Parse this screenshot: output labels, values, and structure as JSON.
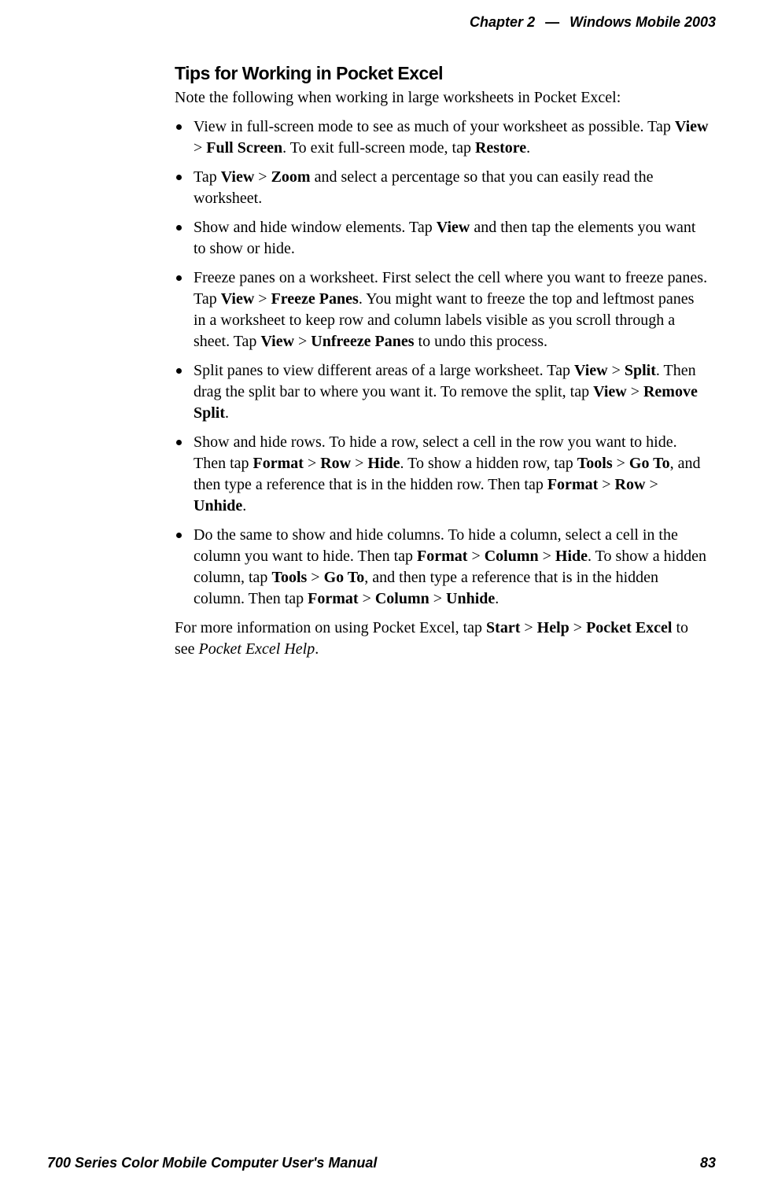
{
  "header": {
    "chapter_label": "Chapter",
    "chapter_num": "2",
    "separator": "—",
    "doc_title": "Windows Mobile 2003"
  },
  "section": {
    "title": "Tips for Working in Pocket Excel",
    "intro": "Note the following when working in large worksheets in Pocket Excel:"
  },
  "bullets": {
    "b1": {
      "pre": "View in full-screen mode to see as much of your worksheet as possible. Tap ",
      "s1": "View",
      "gt1": " > ",
      "s2": "Full Screen",
      "mid": ". To exit full-screen mode, tap ",
      "s3": "Restore",
      "end": "."
    },
    "b2": {
      "pre": "Tap ",
      "s1": "View",
      "gt1": " > ",
      "s2": "Zoom",
      "end": " and select a percentage so that you can easily read the worksheet."
    },
    "b3": {
      "pre": "Show and hide window elements. Tap ",
      "s1": "View",
      "end": " and then tap the elements you want to show or hide."
    },
    "b4": {
      "pre": "Freeze panes on a worksheet. First select the cell where you want to freeze panes. Tap ",
      "s1": "View",
      "gt1": " > ",
      "s2": "Freeze Panes",
      "mid": ". You might want to freeze the top and leftmost panes in a worksheet to keep row and column labels visible as you scroll through a sheet. Tap ",
      "s3": "View",
      "gt2": " > ",
      "s4": "Unfreeze Panes",
      "end": " to undo this process."
    },
    "b5": {
      "pre": "Split panes to view different areas of a large worksheet. Tap ",
      "s1": "View",
      "gt1": " > ",
      "s2": "Split",
      "mid": ". Then drag the split bar to where you want it. To remove the split, tap ",
      "s3": "View",
      "gt2": " > ",
      "s4": "Remove Split",
      "end": "."
    },
    "b6": {
      "pre": "Show and hide rows. To hide a row, select a cell in the row you want to hide. Then tap ",
      "s1": "Format",
      "gt1": " > ",
      "s2": "Row",
      "gt2": "  > ",
      "s3": "Hide",
      "mid": ". To show a hidden row, tap ",
      "s4": "Tools",
      "gt3": " > ",
      "s5": "Go To",
      "mid2": ", and then type a reference that is in the hidden row. Then tap ",
      "s6": "Format",
      "gt4": " > ",
      "s7": "Row",
      "gt5": " > ",
      "s8": "Unhide",
      "end": "."
    },
    "b7": {
      "pre": "Do the same to show and hide columns. To hide a column, select a cell in the column you want to hide. Then tap ",
      "s1": "Format",
      "gt1": " > ",
      "s2": "Column",
      "gt2": " > ",
      "s3": "Hide",
      "mid": ". To show a hidden column, tap ",
      "s4": "Tools",
      "gt3": " > ",
      "s5": "Go To",
      "mid2": ", and then type a reference that is in the hidden column. Then tap ",
      "s6": "Format",
      "gt4": " > ",
      "s7": "Column",
      "gt5": " > ",
      "s8": "Unhide",
      "end": "."
    }
  },
  "closing": {
    "pre": "For more information on using Pocket Excel, tap ",
    "s1": "Start",
    "gt1": " > ",
    "s2": "Help",
    "gt2": " > ",
    "s3": "Pocket Excel",
    "mid": " to see ",
    "it": "Pocket Excel Help",
    "end": "."
  },
  "footer": {
    "left": "700 Series Color Mobile Computer User's Manual",
    "right": "83"
  }
}
